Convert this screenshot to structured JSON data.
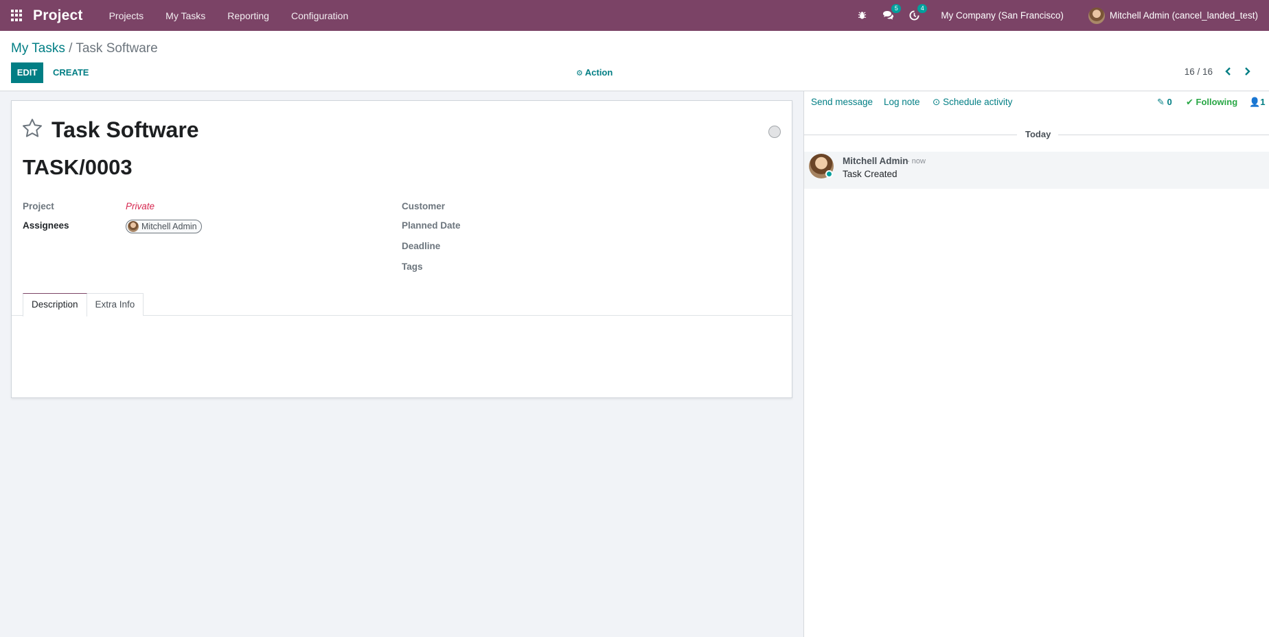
{
  "navbar": {
    "app_name": "Project",
    "menu": [
      "Projects",
      "My Tasks",
      "Reporting",
      "Configuration"
    ],
    "messages_count": "5",
    "activities_count": "4",
    "company": "My Company (San Francisco)",
    "user": "Mitchell Admin (cancel_landed_test)"
  },
  "breadcrumb": {
    "parent": "My Tasks",
    "separator": " / ",
    "current": "Task Software"
  },
  "toolbar": {
    "edit_label": "EDIT",
    "create_label": "CREATE",
    "action_label": "Action",
    "pager": "16 / 16"
  },
  "form": {
    "title": "Task Software",
    "reference": "TASK/0003",
    "fields_left": [
      {
        "label": "Project",
        "value": "Private"
      },
      {
        "label": "Assignees",
        "value": "Mitchell Admin"
      }
    ],
    "fields_right": [
      {
        "label": "Customer"
      },
      {
        "label": "Planned Date"
      },
      {
        "label": "Deadline"
      },
      {
        "label": "Tags"
      }
    ],
    "tabs": [
      "Description",
      "Extra Info"
    ]
  },
  "chatter": {
    "send_message": "Send message",
    "log_note": "Log note",
    "schedule_activity": "Schedule activity",
    "attachments_count": "0",
    "following": "Following",
    "followers_count": "1",
    "date_separator": "Today",
    "messages": [
      {
        "author": "Mitchell Admin",
        "date": "- now",
        "body": "Task Created"
      }
    ]
  },
  "colors": {
    "navbar": "#7b4366",
    "primary": "#017e84",
    "danger": "#d6274f",
    "success": "#28a745"
  }
}
